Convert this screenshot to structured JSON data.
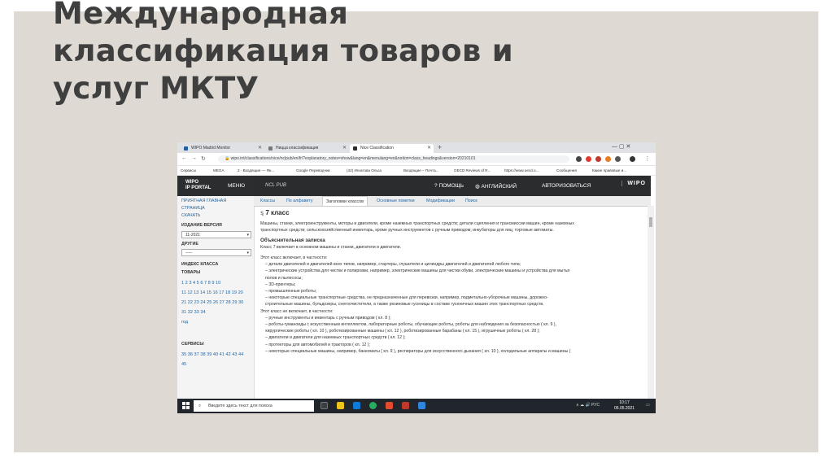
{
  "slide": {
    "title_lines": [
      "Международная",
      "классификация товаров и",
      "услуг МКТУ"
    ]
  },
  "browser": {
    "tabs": [
      {
        "label": "WIPO Madrid Monitor",
        "favicon_color": "#1f5fa8"
      },
      {
        "label": "Ницца классификация",
        "favicon_color": "#777777"
      },
      {
        "label": "Nice Classification",
        "favicon_color": "#2b2d2f",
        "active": true
      }
    ],
    "new_tab": "+",
    "window_controls": "—  ▢  ✕",
    "url": "wipo.int/classifications/nice/nclpub/en/fr/?explanatory_notes=show&lang=en&menulang=en&notion=class_headings&version=20210101",
    "bookmarks": [
      "Сервисы",
      "MEGA",
      "2 · Входящие — Ян...",
      "Google Переводчик",
      "(42) Игнатова Ольга",
      "Входящие – Почта...",
      "OECD Reviews of R...",
      "https://www.oecd.o...",
      "Сообщения",
      "Какие правовые и..."
    ],
    "extension_colors": [
      "#444444",
      "#e03a2e",
      "#c0392b",
      "#e67e22",
      "#555555",
      "#333333"
    ]
  },
  "wipo": {
    "logo": [
      "WIPO",
      "IP PORTAL"
    ],
    "menu": "МЕНЮ",
    "ncl": "NCL PUB",
    "help": "ПОМОЩЬ",
    "lang": "АНГЛИЙСКИЙ",
    "login": "АВТОРИЗОВАТЬСЯ",
    "wipo_right": "WIPO"
  },
  "sidebar": {
    "home": "ПРИЯТНАЯ ГЛАВНАЯ",
    "page": "СТРАНИЦА",
    "download": "СКАЧАТЬ",
    "edition_label": "ИЗДАНИЕ-ВЕРСИЯ",
    "edition_value": "11-2021",
    "other_label": "ДРУГИЕ",
    "other_value": "-----",
    "index_label": "ИНДЕКС КЛАССА",
    "goods_label": "ТОВАРЫ",
    "goods_rows": [
      "1 2 3 4 5 6 7 8 9 10",
      "11 12 13 14 15 16 17 18 19 20",
      "21 22 23 24 25 26 27 28 29 30",
      "31 32 33 34",
      "год"
    ],
    "services_label": "СЕРВИСЫ",
    "services_rows": [
      "35 36 37 38 39 40 41 42 43 44",
      "45"
    ]
  },
  "subtabs": [
    "Классы",
    "По алфавиту",
    "Заголовки классов",
    "Основные пометки",
    "Модификации",
    "Поиск"
  ],
  "content": {
    "title_pref": "Ȿ",
    "title": "7 класс",
    "heading_text": [
      "Машины, станки, электроинструменты, моторы и двигатели, кроме наземных транспортных средств; детали сцепления и трансмиссии машин, кроме наземных",
      "транспортных средств; сельскохозяйственный инвентарь, кроме ручных инструментов с ручным приводом; инкубаторы для яиц; торговые автоматы."
    ],
    "note_label": "Объяснительная записка",
    "note_text": "Класс 7 включает в основном машины и станки, двигатели и двигатели.",
    "includes": "Этот класс включает, в частности:",
    "inc_items": [
      "– детали двигателей и двигателей всех типов, например, стартеры, глушители и цилиндры двигателей и двигателей любого типа;",
      "– электрические устройства для чистки и полировки, например, электрические машины для чистки обуви, электрические машины и устройства для мытья",
      "полов и пылесосы;",
      "– 3D-принтеры;",
      "– промышленные роботы;",
      "– некоторые специальные транспортные средства, не предназначенные для перевозки, например, подметально-уборочные машины, дорожно-",
      "строительные машины, бульдозеры, снегоочистители, а также резиновые гусеницы в составе гусеничных машин этих транспортных средств."
    ],
    "excludes": "Этот класс не включает, в частности:",
    "exc_items": [
      "– ручные инструменты и инвентарь с ручным приводом ( кл. 8 );",
      "– роботы-гуманоиды с искусственным интеллектом, лабораторные роботы, обучающие роботы, роботы для наблюдения за безопасностью ( кл. 9 ),",
      "хирургические роботы ( кл. 10 ), роботизированные машины ( кл. 12 ), роботизированные барабаны ( кл. 15 ), игрушечные роботы ( кл. 28 );",
      "– двигатели и двигатели для наземных транспортных средств ( кл. 12 );",
      "– протекторы для автомобилей и тракторов ( кл. 12 );",
      "– некоторые специальные машины, например, банкоматы ( кл. 9 ), респираторы для искусственного дыхания ( кл. 10 ), холодильные аппараты и машины ("
    ]
  },
  "taskbar": {
    "search_placeholder": "Введите здесь текст для поиска",
    "app_colors": [
      "#3a3f44",
      "#f0c419",
      "#0f7bd8",
      "#27ae60",
      "#e34b2f",
      "#c0392b",
      "#2e86de"
    ],
    "tray": "∧  ☁  🔊  РУС",
    "time": "10:17",
    "date": "05.05.2021"
  }
}
